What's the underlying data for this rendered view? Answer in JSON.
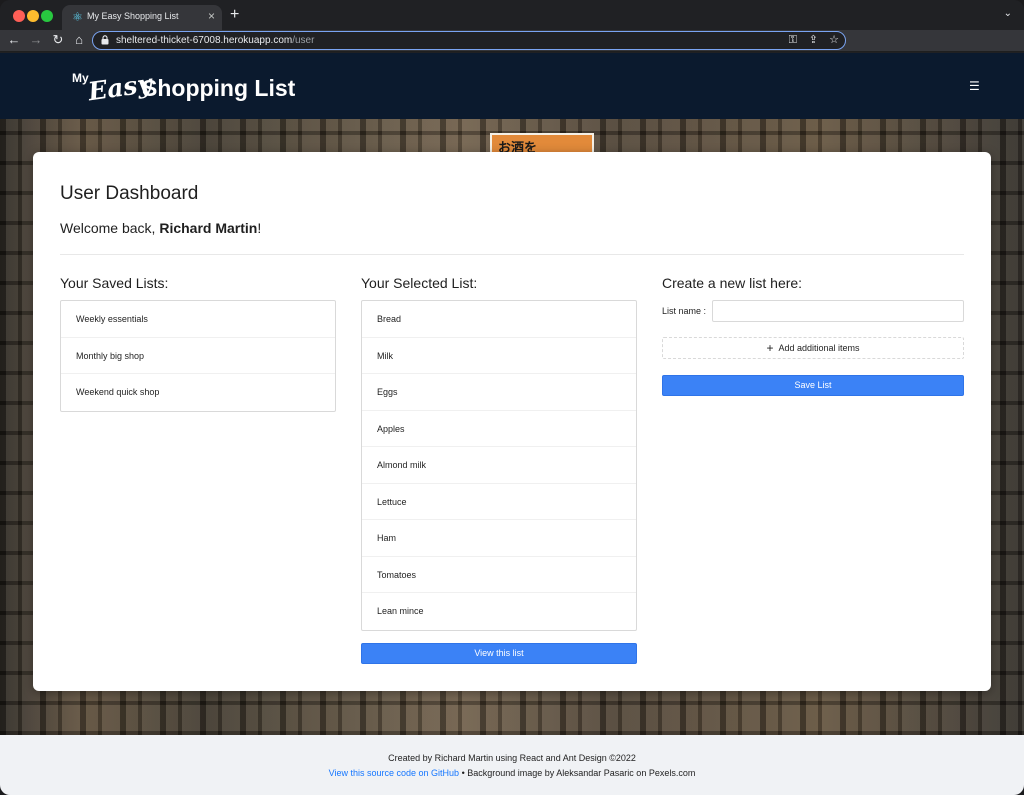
{
  "browser": {
    "tab_title": "My Easy Shopping List",
    "url_host": "sheltered-thicket-67008.herokuapp.com",
    "url_path": "/user",
    "new_tab_label": "+",
    "tab_close_label": "×"
  },
  "header": {
    "logo_my": "My",
    "logo_easy": "Easy",
    "logo_shopping": "Shopping List",
    "menu_icon": "☰"
  },
  "background": {
    "sign_text": "お酒を"
  },
  "dashboard": {
    "title": "User Dashboard",
    "welcome_prefix": "Welcome back, ",
    "user_name": "Richard Martin",
    "welcome_suffix": "!"
  },
  "saved_lists": {
    "heading": "Your Saved Lists:",
    "items": [
      "Weekly essentials",
      "Monthly big shop",
      "Weekend quick shop"
    ]
  },
  "selected_list": {
    "heading": "Your Selected List:",
    "items": [
      "Bread",
      "Milk",
      "Eggs",
      "Apples",
      "Almond milk",
      "Lettuce",
      "Ham",
      "Tomatoes",
      "Lean mince"
    ],
    "view_button": "View this list"
  },
  "new_list": {
    "heading": "Create a new list here:",
    "name_label": "List name",
    "name_value": "",
    "add_items_button": "Add additional items",
    "save_button": "Save List"
  },
  "footer": {
    "credit": "Created by Richard Martin using React and Ant Design ©2022",
    "source_link": "View this source code on GitHub",
    "background_credit": " • Background image by Aleksandar Pasaric on Pexels.com"
  },
  "colors": {
    "header_bg": "#0b1a2e",
    "primary": "#3b82f6",
    "link": "#1677ff",
    "footer_bg": "#f0f2f5"
  }
}
